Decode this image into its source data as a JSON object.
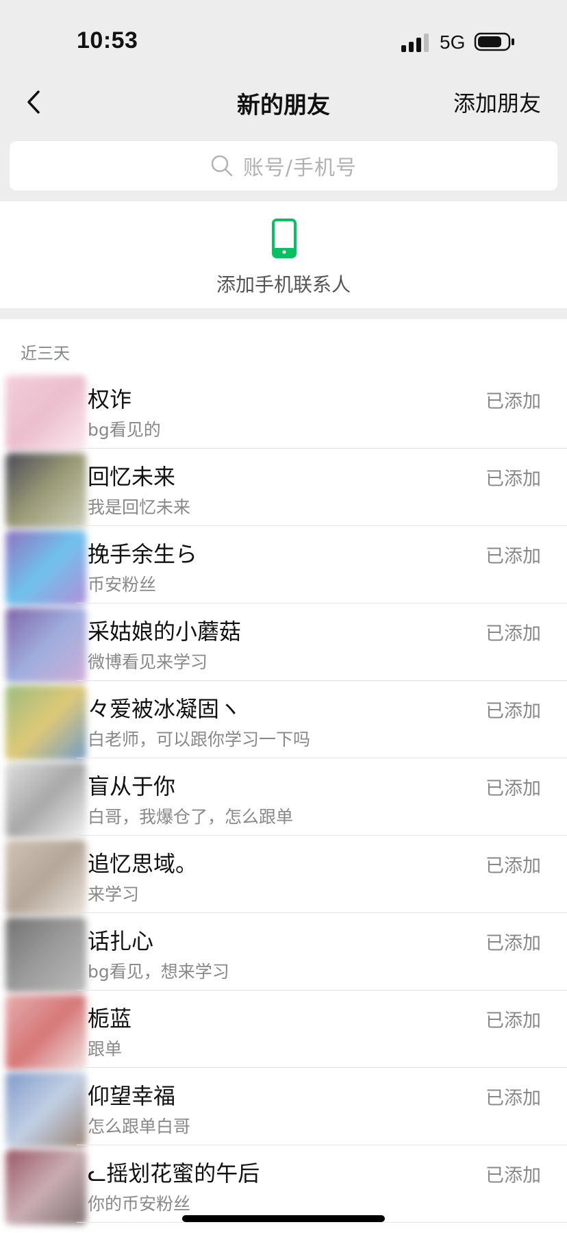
{
  "status_bar": {
    "time": "10:53",
    "network": "5G",
    "icons": [
      "signal-icon",
      "battery-icon"
    ]
  },
  "nav": {
    "back_icon": "chevron-left-icon",
    "title": "新的朋友",
    "action": "添加朋友"
  },
  "search": {
    "icon": "search-icon",
    "placeholder": "账号/手机号"
  },
  "phone_contacts": {
    "icon": "phone-icon",
    "label": "添加手机联系人",
    "accent_color": "#07c160"
  },
  "recent": {
    "header": "近三天",
    "friends": [
      {
        "name": "权诈",
        "note": "bg看见的",
        "status": "已添加",
        "avatar_colors": [
          "#f1c6d3",
          "#e8b3c5",
          "#fbe6ee"
        ]
      },
      {
        "name": "回忆未来",
        "note": "我是回忆未来",
        "status": "已添加",
        "avatar_colors": [
          "#2a2a3a",
          "#8a8a60",
          "#c8c8b0"
        ]
      },
      {
        "name": "挽手余生ら",
        "note": "币安粉丝",
        "status": "已添加",
        "avatar_colors": [
          "#7d5ab5",
          "#57b8ea",
          "#a47ad0"
        ]
      },
      {
        "name": "采姑娘的小蘑菇",
        "note": "微博看见来学习",
        "status": "已添加",
        "avatar_colors": [
          "#6a4a9a",
          "#8fa0d8",
          "#c8a0d0"
        ]
      },
      {
        "name": "々爱被冰凝固ヽ",
        "note": "白老师，可以跟你学习一下吗",
        "status": "已添加",
        "avatar_colors": [
          "#8ab06a",
          "#d8c060",
          "#5a8ac0"
        ]
      },
      {
        "name": "盲从于你",
        "note": "白哥，我爆仓了，怎么跟单",
        "status": "已添加",
        "avatar_colors": [
          "#d8d8d8",
          "#9a9a9a",
          "#f0f0f0"
        ]
      },
      {
        "name": "追忆思域。",
        "note": "来学习",
        "status": "已添加",
        "avatar_colors": [
          "#c8b8a8",
          "#a89888",
          "#e8e0d8"
        ]
      },
      {
        "name": "话扎心",
        "note": "bg看见，想来学习",
        "status": "已添加",
        "avatar_colors": [
          "#5a5a5a",
          "#8a8a8a",
          "#b0b0b0"
        ]
      },
      {
        "name": "栀蓝",
        "note": "跟单",
        "status": "已添加",
        "avatar_colors": [
          "#e0a0a0",
          "#d06060",
          "#f0e0e0"
        ]
      },
      {
        "name": "仰望幸福",
        "note": "怎么跟单白哥",
        "status": "已添加",
        "avatar_colors": [
          "#6a8ac0",
          "#b8c8e0",
          "#8a7060"
        ]
      },
      {
        "name": "ᓚ摇划花蜜的午后",
        "note": "你的币安粉丝",
        "status": "已添加",
        "avatar_colors": [
          "#8a3a4a",
          "#c0a0a8",
          "#6a5a5a"
        ]
      }
    ]
  },
  "home_indicator": "home-indicator"
}
